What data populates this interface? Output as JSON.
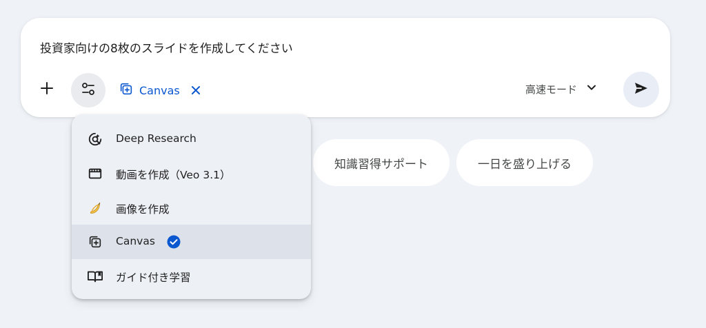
{
  "prompt": {
    "text": "投資家向けの8枚のスライドを作成してください"
  },
  "toolbar": {
    "add_icon": "plus-icon",
    "tools_icon": "tune-icon",
    "active_tool": {
      "label": "Canvas",
      "icon": "canvas-icon",
      "close_icon": "close-icon"
    },
    "mode": {
      "label": "高速モード",
      "icon": "chevron-down-icon"
    },
    "send_icon": "send-icon"
  },
  "suggestions": [
    {
      "label": "知識習得サポート"
    },
    {
      "label": "一日を盛り上げる"
    }
  ],
  "tools_menu": {
    "items": [
      {
        "label": "Deep Research",
        "icon": "deep-research-icon"
      },
      {
        "label": "動画を作成（Veo 3.1）",
        "icon": "video-icon"
      },
      {
        "label": "画像を作成",
        "icon": "banana-icon"
      },
      {
        "label": "Canvas",
        "icon": "canvas-icon",
        "selected": true,
        "badge": "check-circle-icon"
      },
      {
        "label": "ガイド付き学習",
        "icon": "book-icon"
      }
    ]
  },
  "colors": {
    "accent": "#0b57d0",
    "background": "#eff2f7",
    "card": "#ffffff",
    "menu_bg": "#edf0f5",
    "selected_bg": "#dde2ea"
  }
}
